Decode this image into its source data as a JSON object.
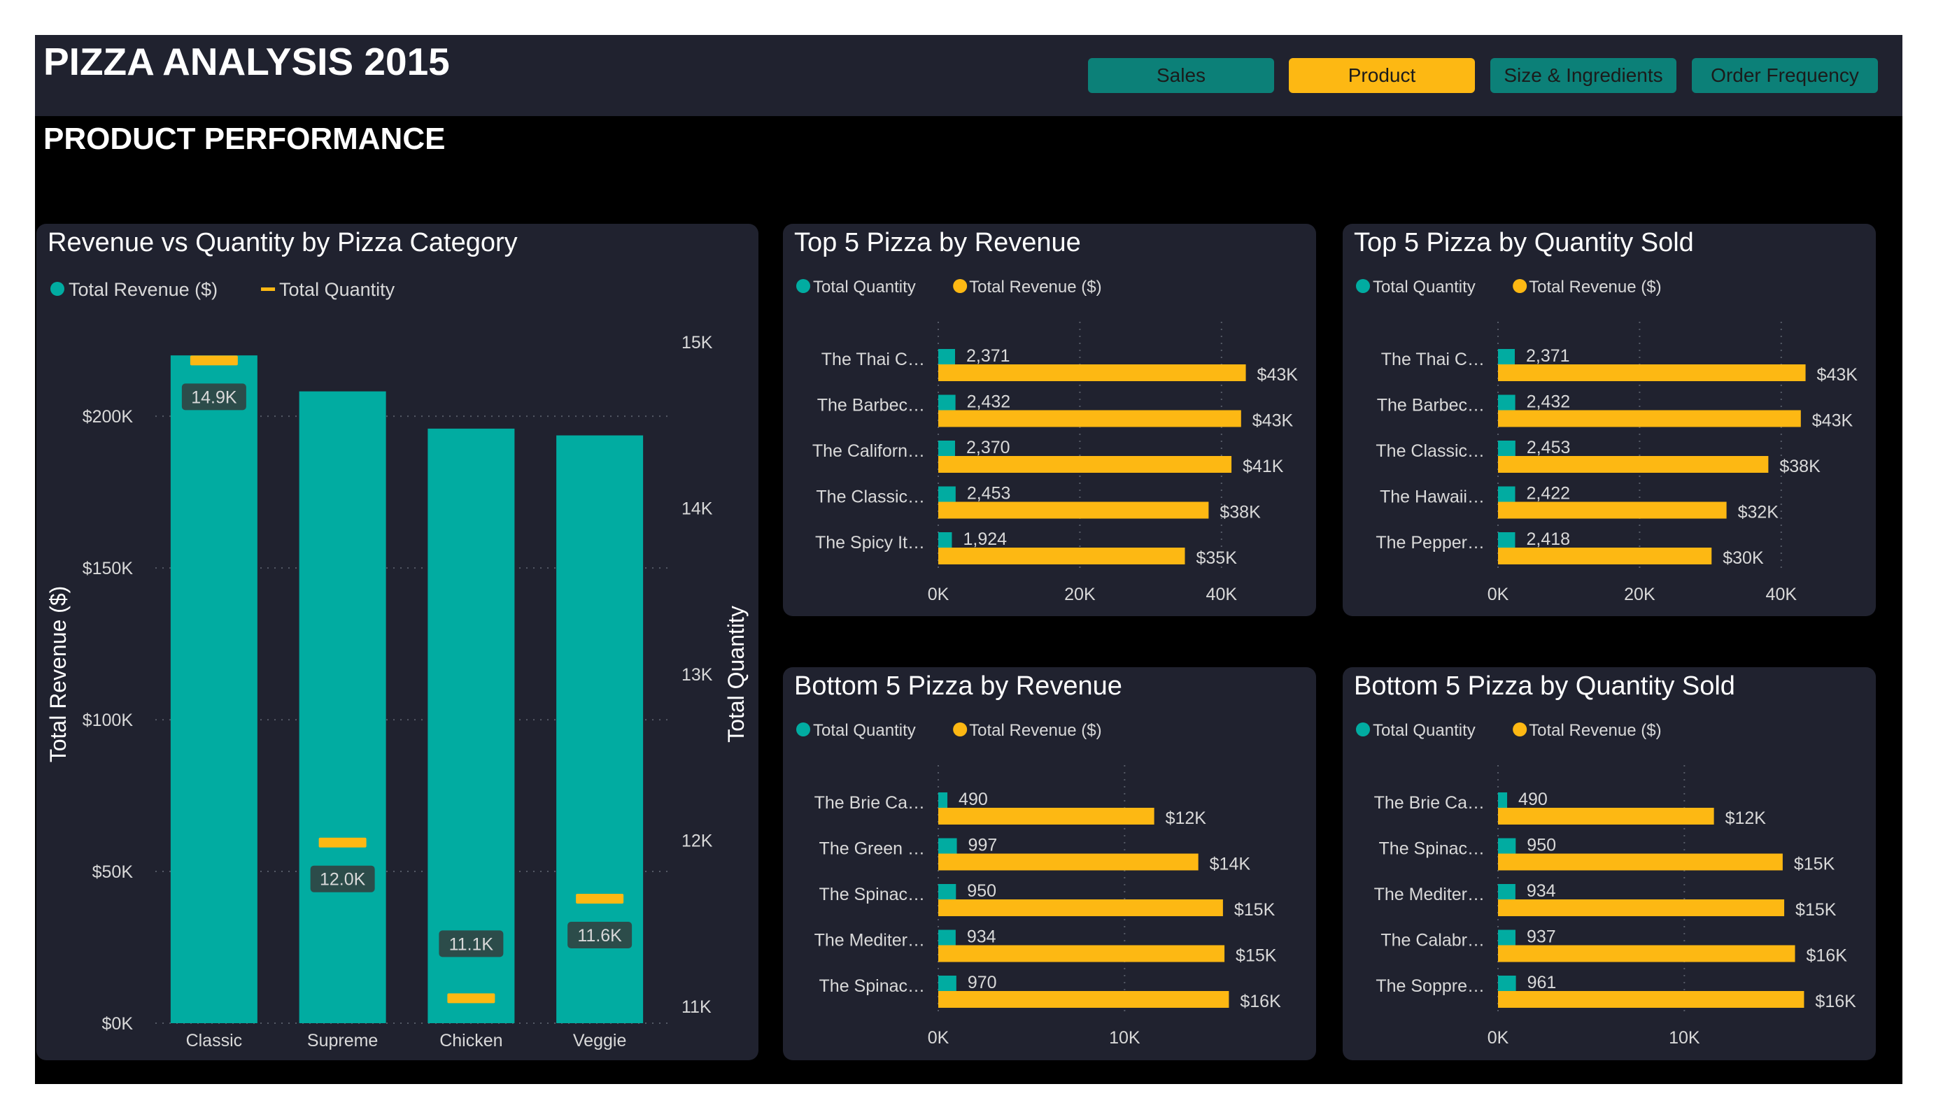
{
  "header": {
    "title": "PIZZA ANALYSIS 2015",
    "nav": [
      {
        "label": "Sales",
        "bg": "#0c8078",
        "fg": "#1b1b1b"
      },
      {
        "label": "Product",
        "bg": "#fdb813",
        "fg": "#1b1b1b"
      },
      {
        "label": "Size & Ingredients",
        "bg": "#0c8078",
        "fg": "#1b1b1b"
      },
      {
        "label": "Order Frequency",
        "bg": "#0c8078",
        "fg": "#1b1b1b"
      }
    ]
  },
  "page_title": "PRODUCT PERFORMANCE",
  "colors": {
    "teal": "#01aca1",
    "yellow": "#fdb813",
    "panel": "#20222f",
    "text": "#d9d9d9",
    "label_box": "#2c4c4a"
  },
  "chart_data": [
    {
      "id": "combo",
      "type": "bar",
      "title": "Revenue vs Quantity by Pizza Category",
      "legend": [
        "Total Revenue ($)",
        "Total Quantity"
      ],
      "categories": [
        "Classic",
        "Supreme",
        "Chicken",
        "Veggie"
      ],
      "ylabel": "Total Revenue ($)",
      "y2label": "Total Quantity",
      "ylim": [
        0,
        230000
      ],
      "yticks": [
        0,
        50000,
        100000,
        150000,
        200000
      ],
      "yticklabels": [
        "$0K",
        "$50K",
        "$100K",
        "$150K",
        "$200K"
      ],
      "y2lim": [
        10900,
        15100
      ],
      "y2ticks": [
        11000,
        12000,
        13000,
        14000,
        15000
      ],
      "y2ticklabels": [
        "11K",
        "12K",
        "13K",
        "14K",
        "15K"
      ],
      "series": [
        {
          "name": "Total Revenue ($)",
          "type": "bar",
          "values": [
            220053,
            208197,
            195920,
            193690
          ]
        },
        {
          "name": "Total Quantity",
          "type": "marker",
          "values": [
            14888,
            11987,
            11050,
            11649
          ],
          "labels": [
            "14.9K",
            "12.0K",
            "11.1K",
            "11.6K"
          ]
        }
      ]
    },
    {
      "id": "top-rev",
      "type": "bar",
      "title": "Top 5 Pizza by Revenue",
      "legend": [
        "Total Quantity",
        "Total Revenue ($)"
      ],
      "categories": [
        "The Thai C…",
        "The Barbec…",
        "The Californ…",
        "The Classic…",
        "The Spicy It…"
      ],
      "xmax": 50000,
      "xticks": [
        0,
        20000,
        40000
      ],
      "xticklabels": [
        "0K",
        "20K",
        "40K"
      ],
      "series": [
        {
          "name": "Total Quantity",
          "values": [
            2371,
            2432,
            2370,
            2453,
            1924
          ],
          "labels": [
            "2,371",
            "2,432",
            "2,370",
            "2,453",
            "1,924"
          ]
        },
        {
          "name": "Total Revenue ($)",
          "values": [
            43434,
            42768,
            41410,
            38180,
            34831
          ],
          "labels": [
            "$43K",
            "$43K",
            "$41K",
            "$38K",
            "$35K"
          ]
        }
      ]
    },
    {
      "id": "top-qty",
      "type": "bar",
      "title": "Top 5 Pizza by Quantity Sold",
      "legend": [
        "Total Quantity",
        "Total Revenue ($)"
      ],
      "categories": [
        "The Thai C…",
        "The Barbec…",
        "The Classic…",
        "The Hawaii…",
        "The Pepper…"
      ],
      "xmax": 50000,
      "xticks": [
        0,
        20000,
        40000
      ],
      "xticklabels": [
        "0K",
        "20K",
        "40K"
      ],
      "series": [
        {
          "name": "Total Quantity",
          "values": [
            2371,
            2432,
            2453,
            2422,
            2418
          ],
          "labels": [
            "2,371",
            "2,432",
            "2,453",
            "2,422",
            "2,418"
          ]
        },
        {
          "name": "Total Revenue ($)",
          "values": [
            43434,
            42768,
            38180,
            32273,
            30162
          ],
          "labels": [
            "$43K",
            "$43K",
            "$38K",
            "$32K",
            "$30K"
          ]
        }
      ]
    },
    {
      "id": "bottom-rev",
      "type": "bar",
      "title": "Bottom 5 Pizza by Revenue",
      "legend": [
        "Total Quantity",
        "Total Revenue ($)"
      ],
      "categories": [
        "The Brie Ca…",
        "The Green …",
        "The Spinac…",
        "The Mediter…",
        "The Spinac…"
      ],
      "xmax": 19000,
      "xticks": [
        0,
        10000
      ],
      "xticklabels": [
        "0K",
        "10K"
      ],
      "series": [
        {
          "name": "Total Quantity",
          "values": [
            490,
            997,
            950,
            934,
            970
          ],
          "labels": [
            "490",
            "997",
            "950",
            "934",
            "970"
          ]
        },
        {
          "name": "Total Revenue ($)",
          "values": [
            11588,
            13956,
            15278,
            15360,
            15597
          ],
          "labels": [
            "$12K",
            "$14K",
            "$15K",
            "$15K",
            "$16K"
          ]
        }
      ]
    },
    {
      "id": "bottom-qty",
      "type": "bar",
      "title": "Bottom 5 Pizza by Quantity Sold",
      "legend": [
        "Total Quantity",
        "Total Revenue ($)"
      ],
      "categories": [
        "The Brie Ca…",
        "The Spinac…",
        "The Mediter…",
        "The Calabr…",
        "The Soppre…"
      ],
      "xmax": 19000,
      "xticks": [
        0,
        10000
      ],
      "xticklabels": [
        "0K",
        "10K"
      ],
      "series": [
        {
          "name": "Total Quantity",
          "values": [
            490,
            950,
            934,
            937,
            961
          ],
          "labels": [
            "490",
            "950",
            "934",
            "937",
            "961"
          ]
        },
        {
          "name": "Total Revenue ($)",
          "values": [
            11588,
            15278,
            15360,
            15940,
            16425
          ],
          "labels": [
            "$12K",
            "$15K",
            "$15K",
            "$16K",
            "$16K"
          ]
        }
      ]
    }
  ]
}
